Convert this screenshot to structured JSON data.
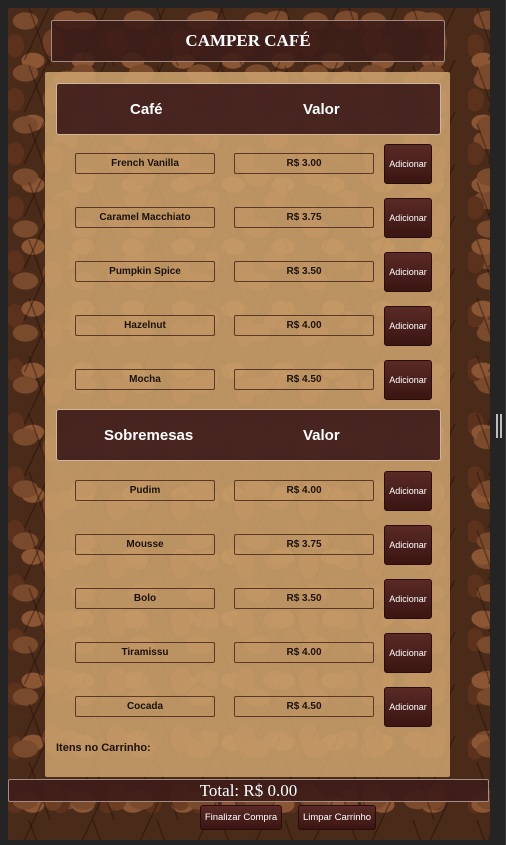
{
  "header": {
    "title": "CAMPER CAFÉ"
  },
  "coffee": {
    "col_item": "Café",
    "col_price": "Valor",
    "items": [
      {
        "name": "French Vanilla",
        "price": "R$ 3.00",
        "button": "Adicionar"
      },
      {
        "name": "Caramel Macchiato",
        "price": "R$ 3.75",
        "button": "Adicionar"
      },
      {
        "name": "Pumpkin Spice",
        "price": "R$ 3.50",
        "button": "Adicionar"
      },
      {
        "name": "Hazelnut",
        "price": "R$ 4.00",
        "button": "Adicionar"
      },
      {
        "name": "Mocha",
        "price": "R$ 4.50",
        "button": "Adicionar"
      }
    ]
  },
  "desserts": {
    "col_item": "Sobremesas",
    "col_price": "Valor",
    "items": [
      {
        "name": "Pudim",
        "price": "R$ 4.00",
        "button": "Adicionar"
      },
      {
        "name": "Mousse",
        "price": "R$ 3.75",
        "button": "Adicionar"
      },
      {
        "name": "Bolo",
        "price": "R$ 3.50",
        "button": "Adicionar"
      },
      {
        "name": "Tiramissu",
        "price": "R$ 4.00",
        "button": "Adicionar"
      },
      {
        "name": "Cocada",
        "price": "R$ 4.50",
        "button": "Adicionar"
      }
    ]
  },
  "cart": {
    "label": "Itens no Carrinho:"
  },
  "footer": {
    "total": "Total: R$ 0.00",
    "finish_label": "Finalizar Compra",
    "clear_label": "Limpar Carrinho"
  },
  "colors": {
    "panel": "#cea36e",
    "header_bg": "#3e1c1a",
    "button_bg": "#4a1f1c"
  }
}
